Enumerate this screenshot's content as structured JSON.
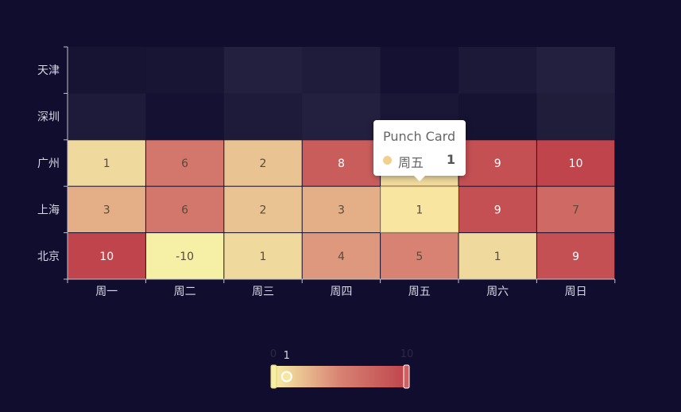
{
  "chart_data": {
    "type": "heatmap",
    "title": "",
    "xlabel": "",
    "ylabel": "",
    "x_categories": [
      "周一",
      "周二",
      "周三",
      "周四",
      "周五",
      "周六",
      "周日"
    ],
    "y_categories": [
      "北京",
      "上海",
      "广州",
      "深圳",
      "天津"
    ],
    "series_name": "Punch Card",
    "cells": [
      {
        "x": "周一",
        "y": "北京",
        "value": 10
      },
      {
        "x": "周二",
        "y": "北京",
        "value": -10
      },
      {
        "x": "周三",
        "y": "北京",
        "value": 1
      },
      {
        "x": "周四",
        "y": "北京",
        "value": 4
      },
      {
        "x": "周五",
        "y": "北京",
        "value": 5
      },
      {
        "x": "周六",
        "y": "北京",
        "value": 1
      },
      {
        "x": "周日",
        "y": "北京",
        "value": 9
      },
      {
        "x": "周一",
        "y": "上海",
        "value": 3
      },
      {
        "x": "周二",
        "y": "上海",
        "value": 6
      },
      {
        "x": "周三",
        "y": "上海",
        "value": 2
      },
      {
        "x": "周四",
        "y": "上海",
        "value": 3
      },
      {
        "x": "周五",
        "y": "上海",
        "value": 1
      },
      {
        "x": "周六",
        "y": "上海",
        "value": 9
      },
      {
        "x": "周日",
        "y": "上海",
        "value": 7
      },
      {
        "x": "周一",
        "y": "广州",
        "value": 1
      },
      {
        "x": "周二",
        "y": "广州",
        "value": 6
      },
      {
        "x": "周三",
        "y": "广州",
        "value": 2
      },
      {
        "x": "周四",
        "y": "广州",
        "value": 8
      },
      {
        "x": "周五",
        "y": "广州",
        "value": 1
      },
      {
        "x": "周六",
        "y": "广州",
        "value": 9
      },
      {
        "x": "周日",
        "y": "广州",
        "value": 10
      }
    ],
    "visual_map": {
      "min": 0,
      "max": 10,
      "selected_range": [
        1,
        10
      ],
      "min_label": "0",
      "max_label": "10",
      "handle_label": "1",
      "colors": [
        "#f6efa6",
        "#d88273",
        "#bf444c"
      ]
    },
    "tooltip": {
      "title": "Punch Card",
      "name": "周五",
      "value": "1",
      "marker_color": "#f0d08c"
    },
    "colors": {
      "background": "#110d2e",
      "axis": "#c0c0d0",
      "label": "#d8d8e8",
      "empty_cell": "#232041"
    }
  }
}
